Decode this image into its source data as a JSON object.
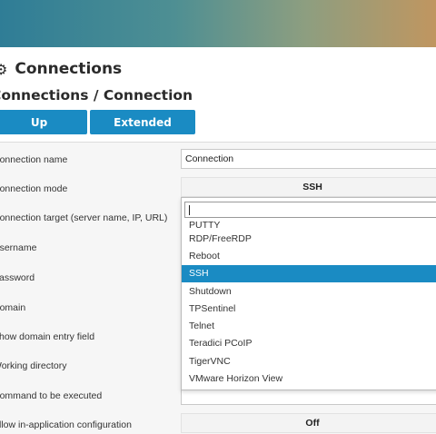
{
  "header": {
    "title": "Connections",
    "breadcrumb": "Connections / Connection"
  },
  "buttons": {
    "up": "Up",
    "extended": "Extended"
  },
  "form": {
    "labels": [
      "Connection name",
      "Connection mode",
      "Connection target (server name, IP, URL)",
      "Username",
      "Password",
      "Domain",
      "Show domain entry field",
      "Working directory",
      "Command to be executed",
      "Allow in-application configuration"
    ],
    "connection_name_value": "Connection",
    "connection_mode_value": "SSH",
    "in_app_config_value": "Off"
  },
  "dropdown": {
    "search_value": "",
    "options": [
      "PUTTY",
      "RDP/FreeRDP",
      "Reboot",
      "SSH",
      "Shutdown",
      "TPSentinel",
      "Telnet",
      "Teradici PCoIP",
      "TigerVNC",
      "VMware Horizon View"
    ],
    "selected": "SSH"
  },
  "colors": {
    "accent": "#1a8bc3",
    "panel_bg": "#f6f6f6"
  },
  "icons": {
    "title_icon": "gear-icon"
  }
}
